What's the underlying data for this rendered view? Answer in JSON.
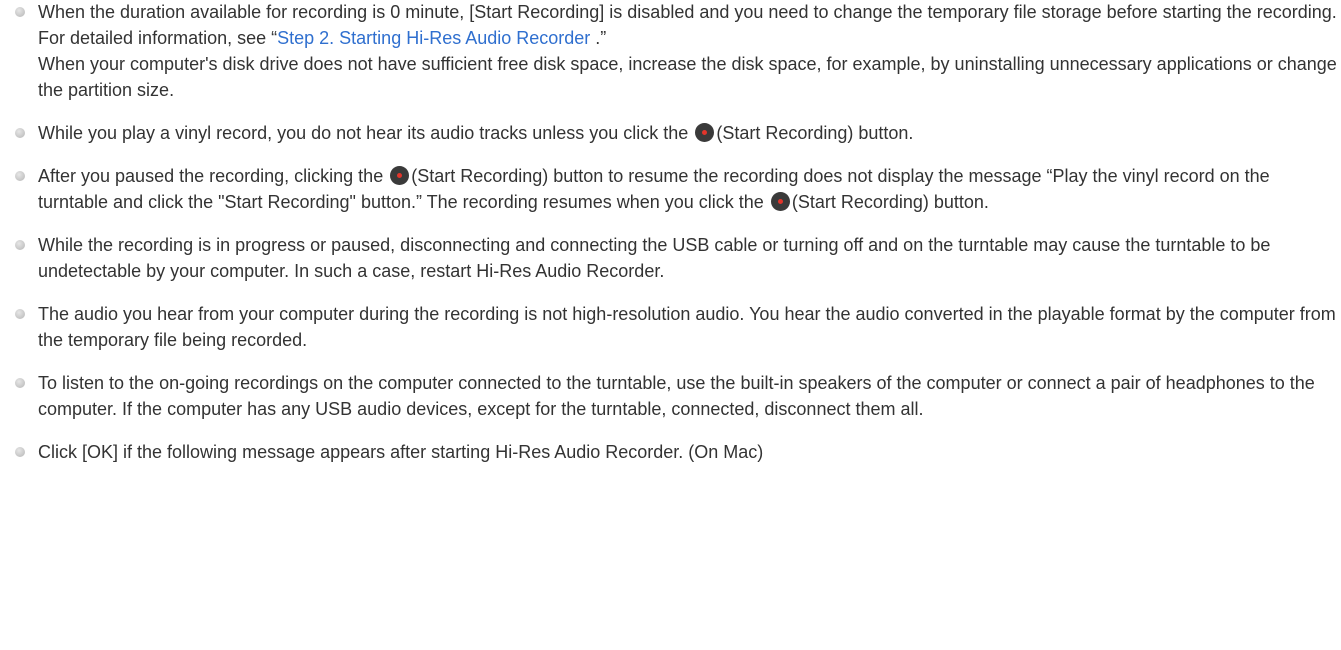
{
  "notes": [
    {
      "line1": "When the duration available for recording is 0 minute, [Start Recording] is disabled and you need to change the temporary file storage before starting the recording. For detailed information, see “",
      "link": "Step 2. Starting Hi-Res Audio Recorder ",
      "line1_after": ".”",
      "line2": "When your computer's disk drive does not have sufficient free disk space, increase the disk space, for example, by uninstalling unnecessary applications or change the partition size."
    },
    {
      "before": "While you play a vinyl record, you do not hear its audio tracks unless you click the ",
      "after": "(Start Recording) button."
    },
    {
      "before": "After you paused the recording, clicking the ",
      "middle": "(Start Recording) button to resume the recording does not display the message “Play the vinyl record on the turntable and click the \"Start Recording\" button.” The recording resumes when you click the ",
      "after": "(Start Recording) button."
    },
    {
      "text": "While the recording is in progress or paused, disconnecting and connecting the USB cable or turning off and on the turntable may cause the turntable to be undetectable by your computer. In such a case, restart Hi-Res Audio Recorder."
    },
    {
      "text": "The audio you hear from your computer during the recording is not high-resolution audio. You hear the audio converted in the playable format by the computer from the temporary file being recorded."
    },
    {
      "text": "To listen to the on-going recordings on the computer connected to the turntable, use the built-in speakers of the computer or connect a pair of headphones to the computer. If the computer has any USB audio devices, except for the turntable, connected, disconnect them all."
    },
    {
      "text": "Click [OK] if the following message appears after starting Hi-Res Audio Recorder. (On Mac)"
    }
  ],
  "icons": {
    "bullet": "grey-dot-bullet",
    "record_button": "start-recording-icon"
  },
  "colors": {
    "text": "#333333",
    "link": "#2f6fcf",
    "record_dot": "#e2352b"
  }
}
